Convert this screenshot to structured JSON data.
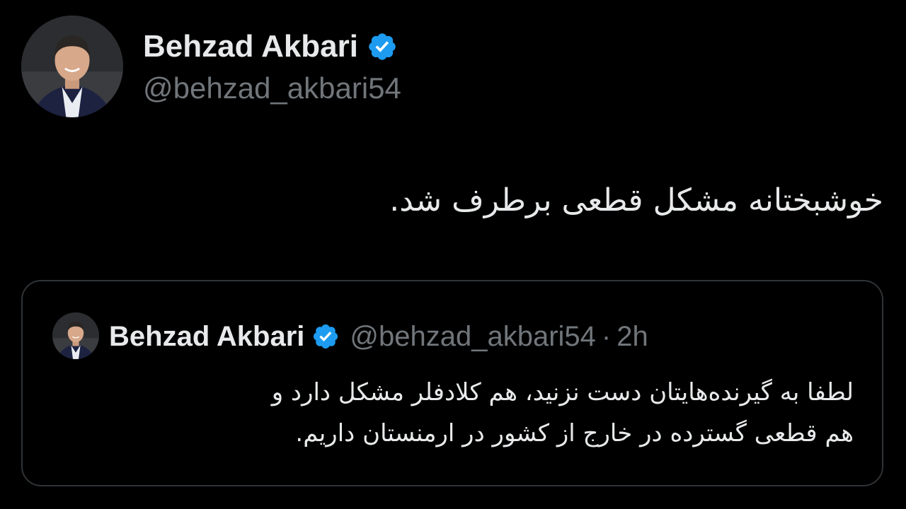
{
  "colors": {
    "background": "#000000",
    "text_primary": "#e7e9ea",
    "text_secondary": "#71767b",
    "verified_badge": "#1d9bf0",
    "card_border": "#2f3336"
  },
  "tweet": {
    "author": {
      "name": "Behzad Akbari",
      "handle": "@behzad_akbari54",
      "verified": true,
      "avatar_icon": "profile-photo"
    },
    "text": "خوشبختانه مشکل قطعی برطرف شد."
  },
  "quoted_tweet": {
    "author": {
      "name": "Behzad Akbari",
      "handle": "@behzad_akbari54",
      "verified": true,
      "avatar_icon": "profile-photo"
    },
    "separator": "·",
    "time": "2h",
    "text_lines": [
      "لطفا به گیرنده‌هایتان دست نزنید، هم کلادفلر مشکل دارد و",
      "هم قطعی گسترده در خارج از کشور در ارمنستان داریم."
    ]
  }
}
